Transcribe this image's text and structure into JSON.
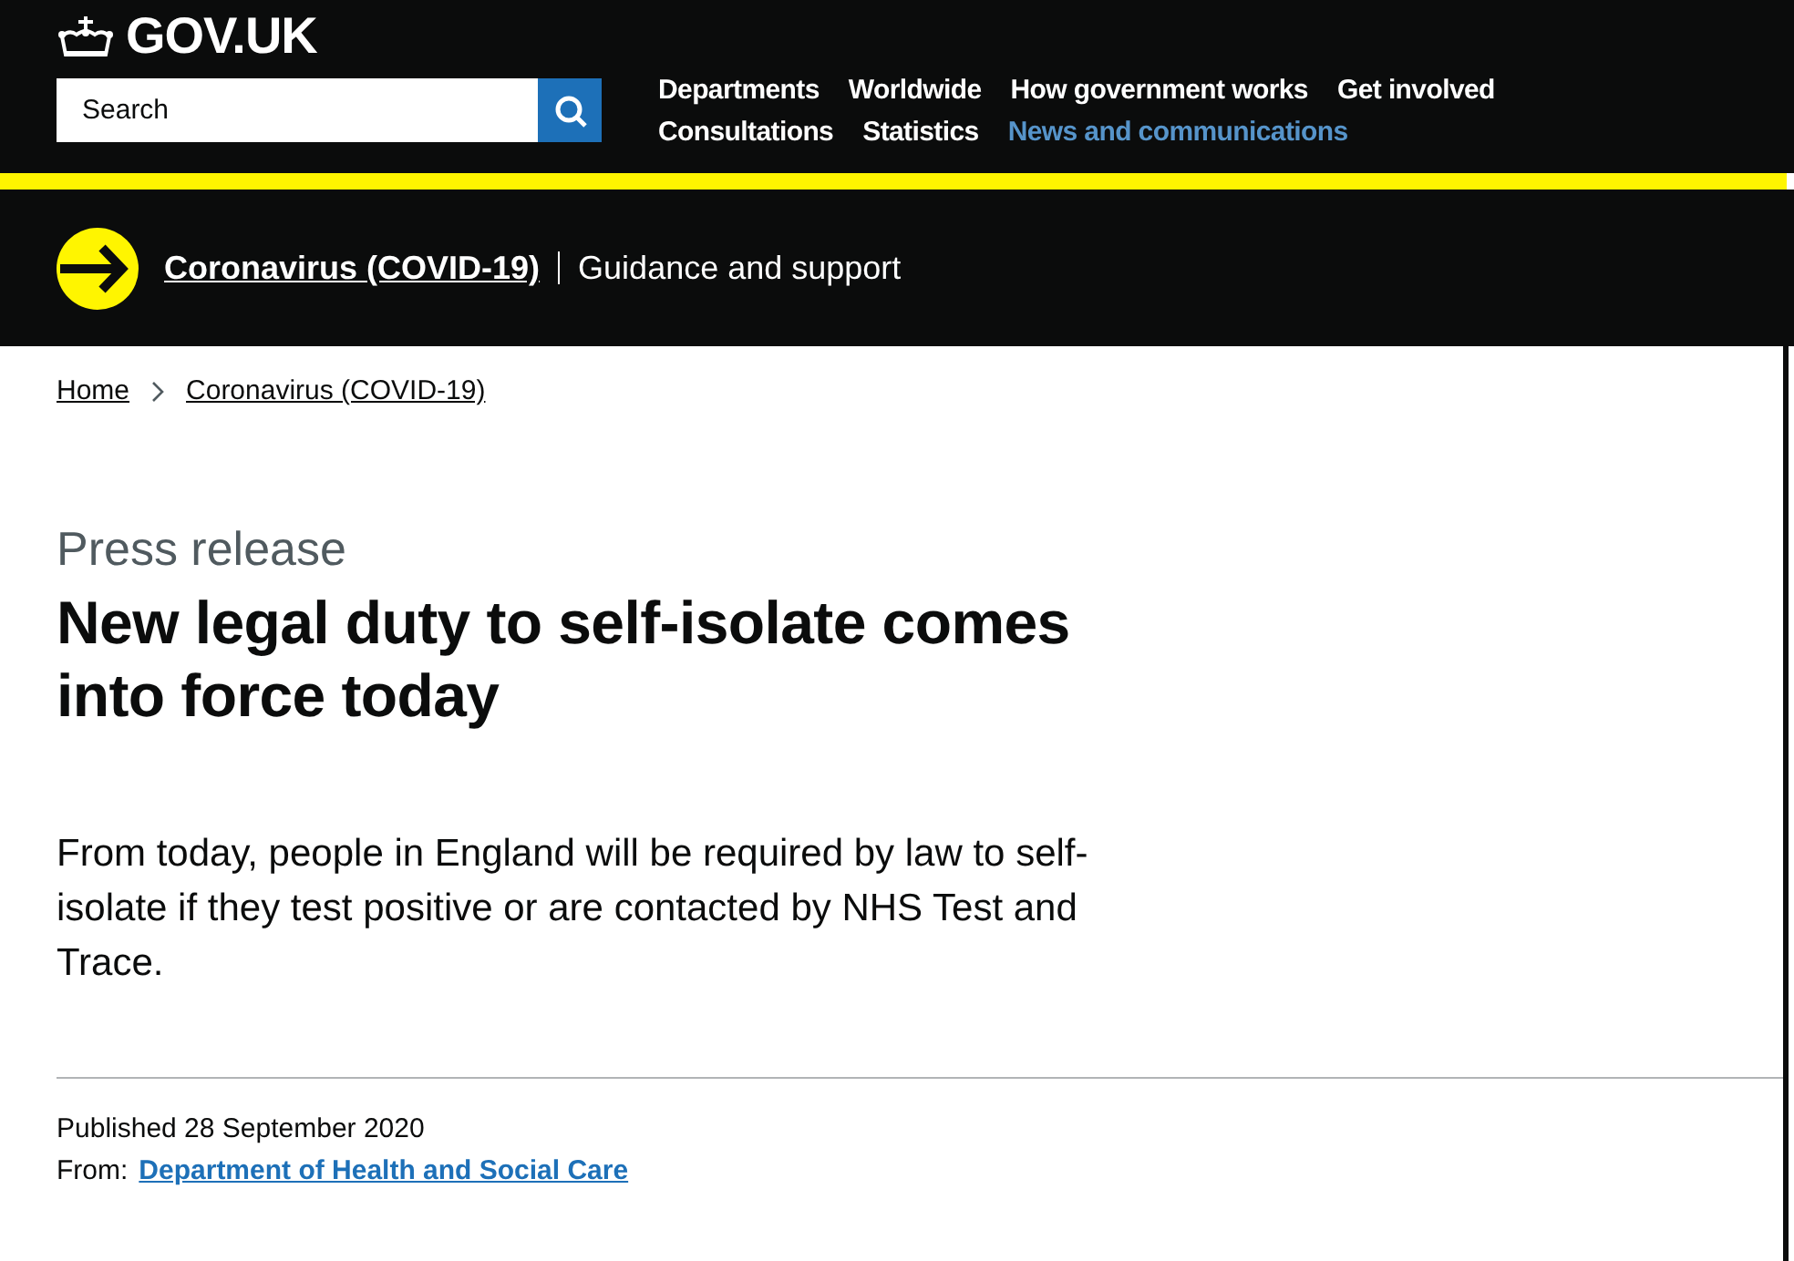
{
  "header": {
    "logo": "GOV.UK",
    "search": {
      "placeholder": "Search"
    },
    "nav": [
      {
        "label": "Departments",
        "selected": false
      },
      {
        "label": "Worldwide",
        "selected": false
      },
      {
        "label": "How government works",
        "selected": false
      },
      {
        "label": "Get involved",
        "selected": false
      },
      {
        "label": "Consultations",
        "selected": false
      },
      {
        "label": "Statistics",
        "selected": false
      },
      {
        "label": "News and communications",
        "selected": true
      }
    ]
  },
  "banner": {
    "link": "Coronavirus (COVID-19)",
    "text": "Guidance and support"
  },
  "breadcrumbs": [
    "Home",
    "Coronavirus (COVID-19)"
  ],
  "article": {
    "type": "Press release",
    "title": "New legal duty to self-isolate comes into force today",
    "lede": "From today, people in England will be required by law to self-isolate if they test positive or are contacted by NHS Test and Trace.",
    "published": "Published 28 September 2020",
    "from_label": "From:",
    "from_link": "Department of Health and Social Care"
  }
}
